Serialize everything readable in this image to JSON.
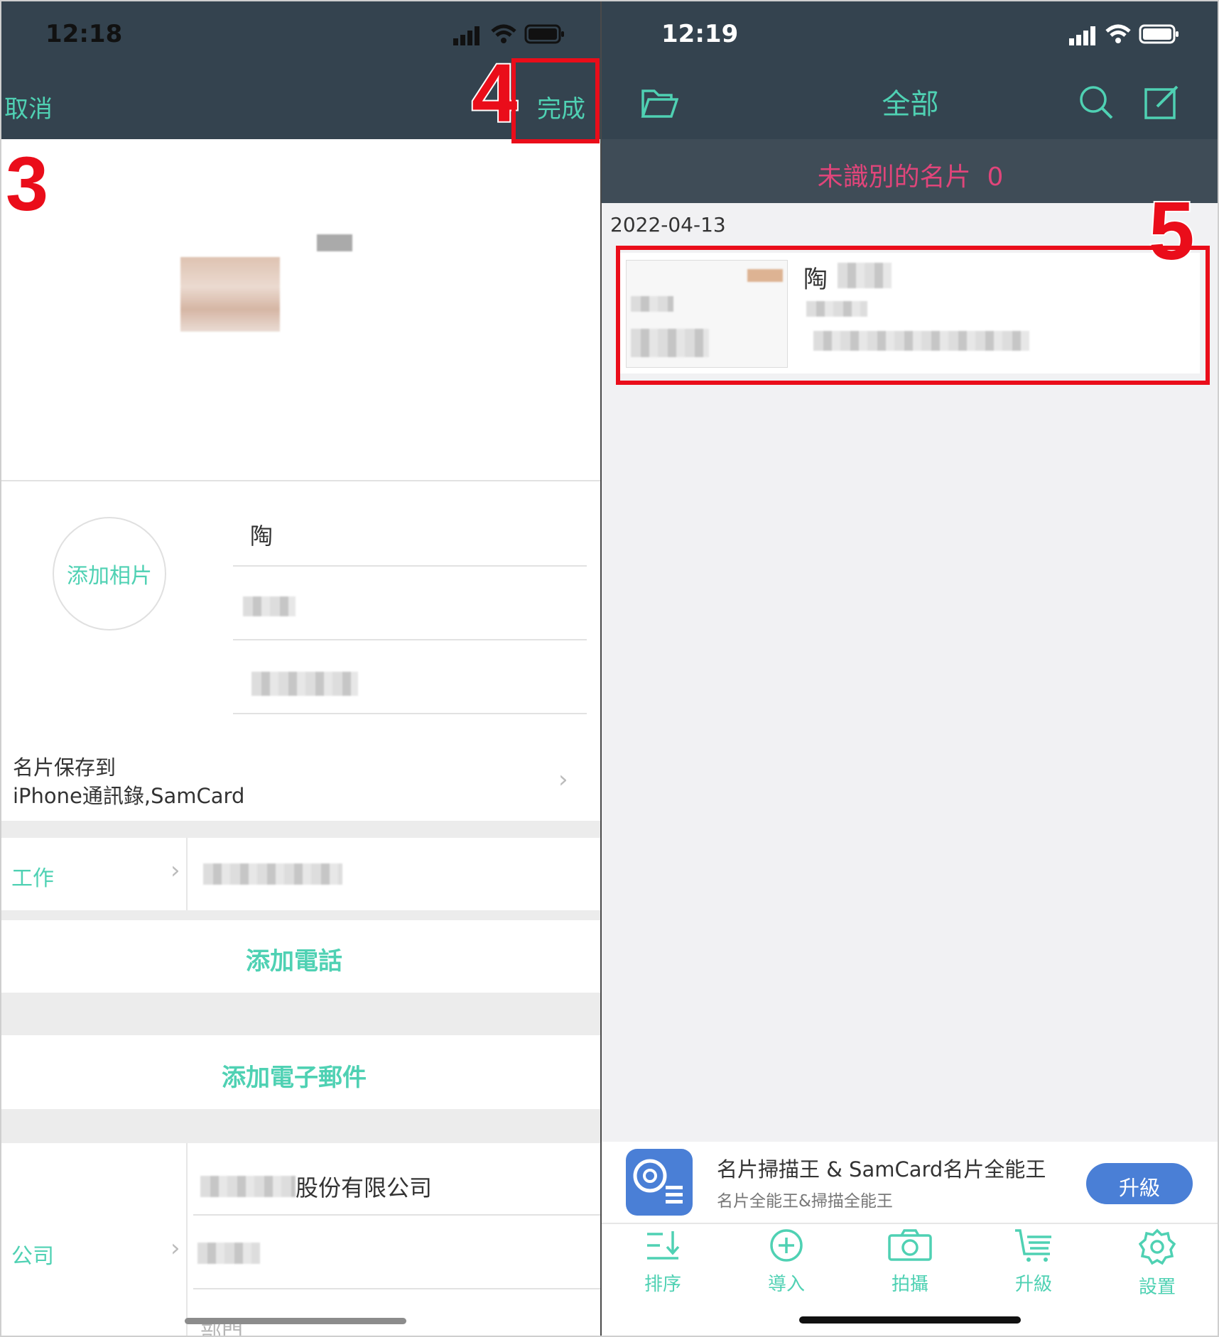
{
  "left": {
    "status_time": "12:18",
    "nav": {
      "cancel": "取消",
      "done": "完成"
    },
    "name_field": "陶",
    "add_photo": "添加相片",
    "save_to": {
      "label": "名片保存到",
      "value": "iPhone通訊錄,SamCard"
    },
    "work_label": "工作",
    "add_phone": "添加電話",
    "add_email": "添加電子郵件",
    "company_label": "公司",
    "company_name_suffix": "股份有限公司",
    "department_placeholder": "部門"
  },
  "right": {
    "status_time": "12:19",
    "title": "全部",
    "unrecognized": "未識別的名片  0",
    "date": "2022-04-13",
    "card_name": "陶",
    "ad": {
      "title": "名片掃描王 & SamCard名片全能王",
      "subtitle": "名片全能王&掃描全能王",
      "button": "升級"
    },
    "tabs": [
      {
        "label": "排序",
        "icon": "sort-icon"
      },
      {
        "label": "導入",
        "icon": "import-icon"
      },
      {
        "label": "拍攝",
        "icon": "camera-icon"
      },
      {
        "label": "升級",
        "icon": "cart-icon"
      },
      {
        "label": "設置",
        "icon": "settings-icon"
      }
    ]
  },
  "annotations": {
    "step3": "3",
    "step4": "4",
    "step5": "5"
  },
  "colors": {
    "nav_bg": "#34434f",
    "accent": "#4fd1b3",
    "annotation_red": "#ea0d1a",
    "pink": "#e0457a",
    "upgrade_blue": "#4a7fd6"
  }
}
